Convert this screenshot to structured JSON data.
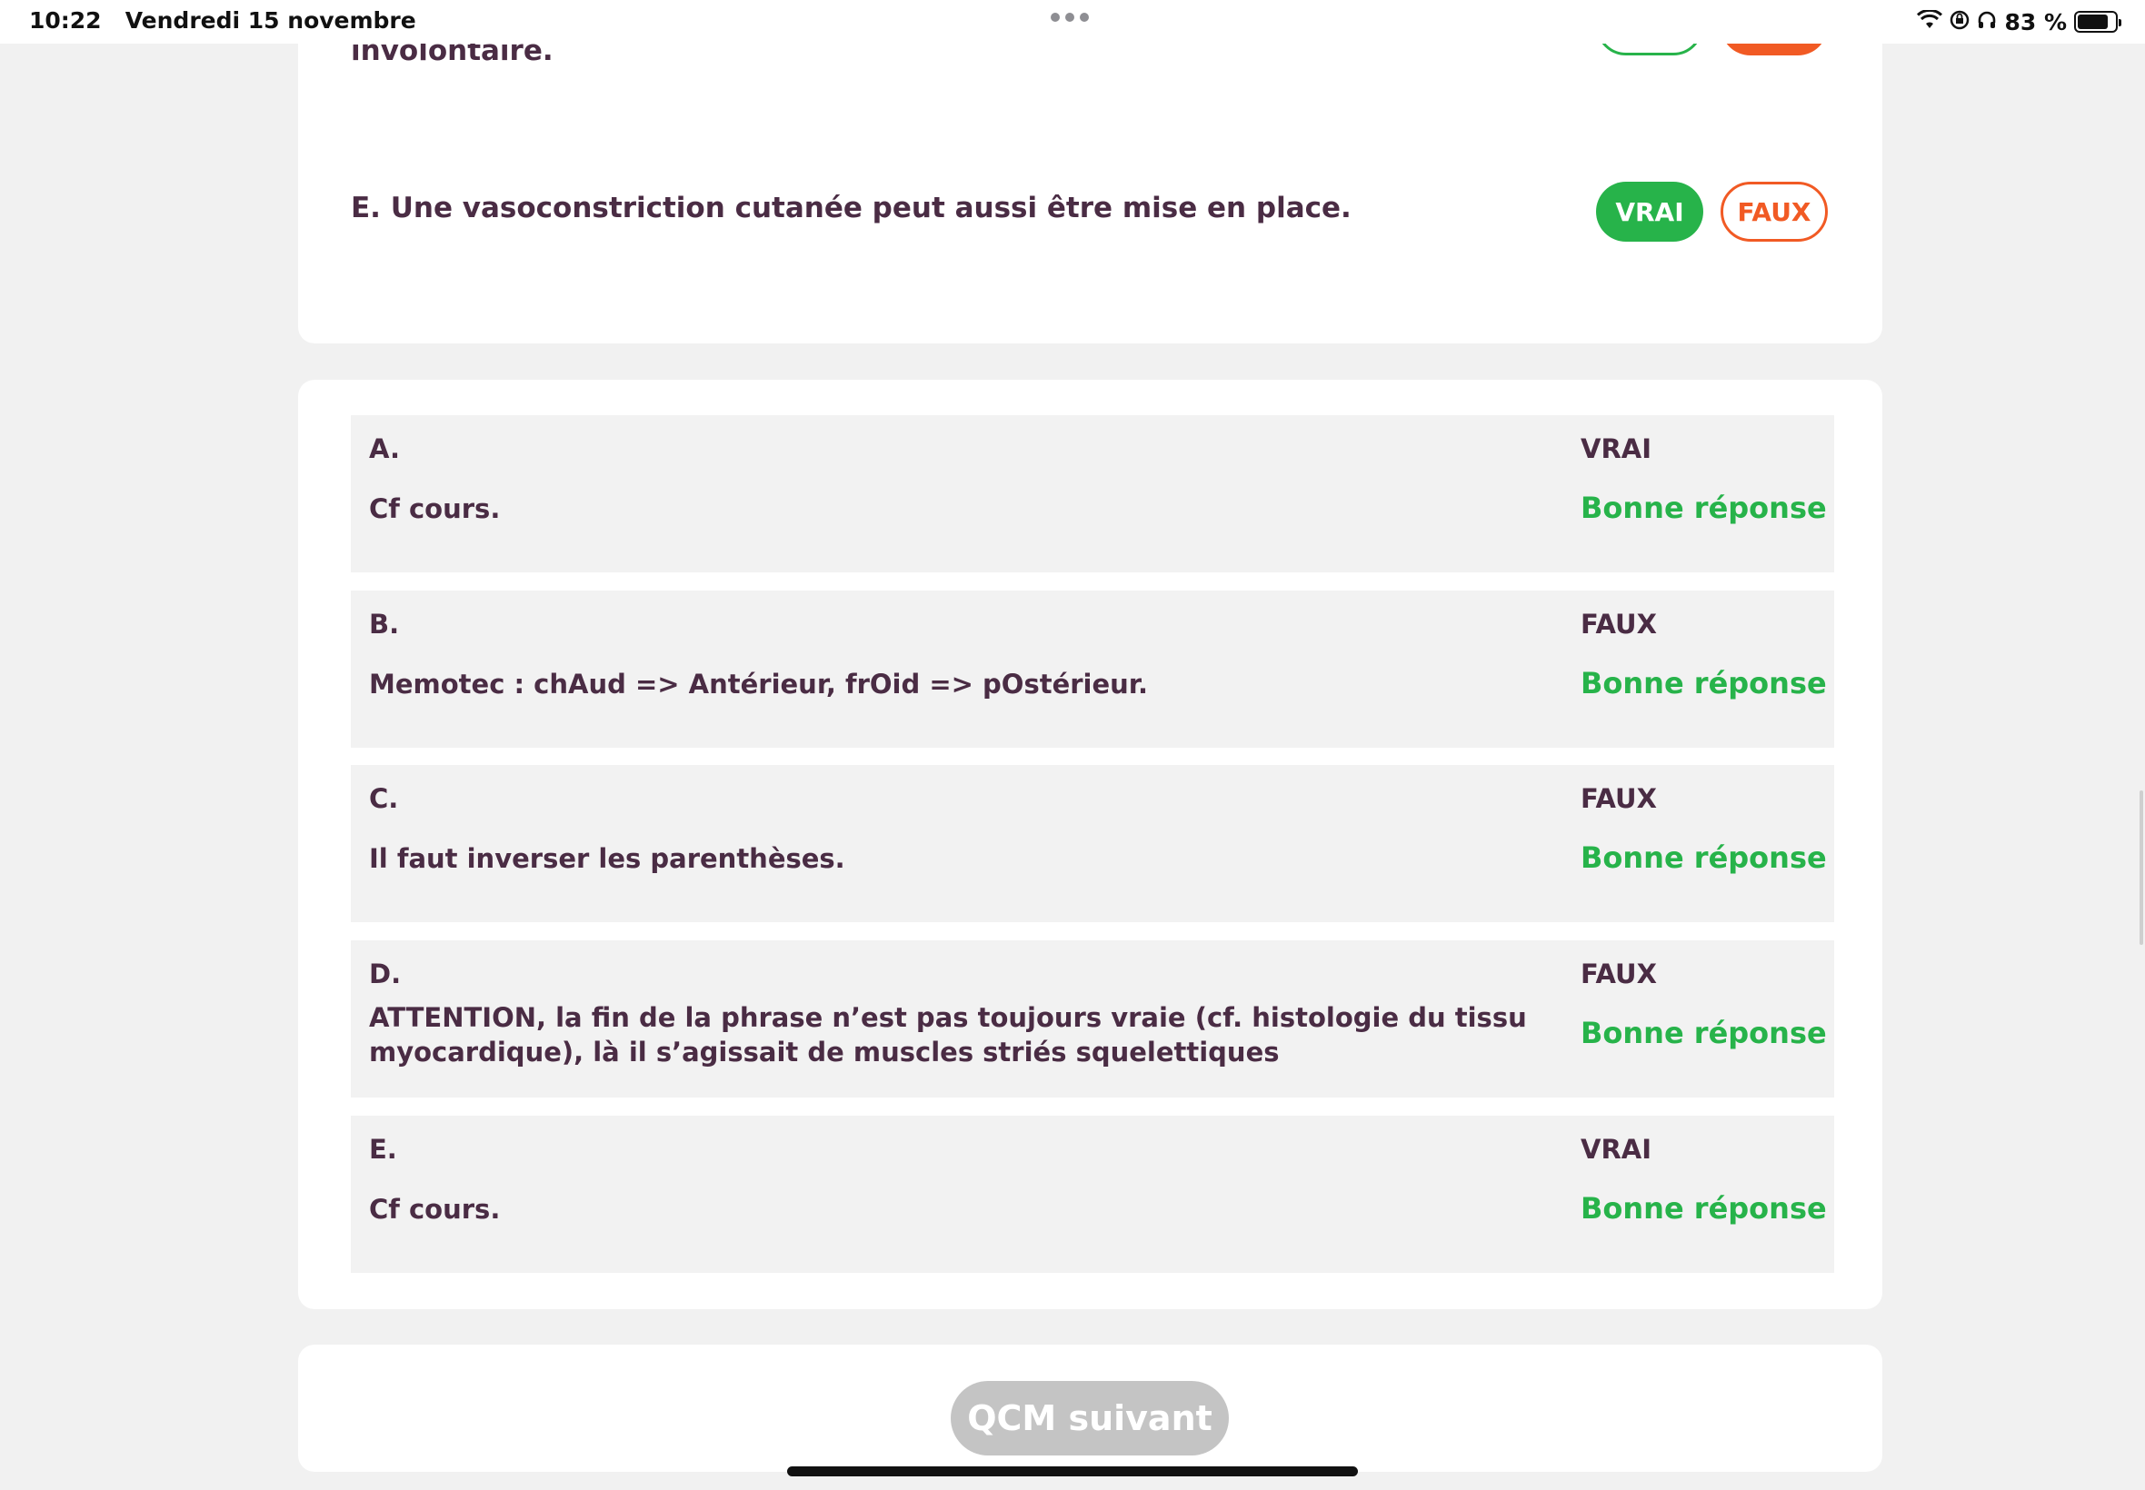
{
  "status_bar": {
    "time_date": "10:22   Vendredi 15 novembre",
    "battery": "83 %"
  },
  "question_card": {
    "partial_text": "involontaire.",
    "statement_e": "E. Une vasoconstriction cutanée peut aussi être mise en place.",
    "vrai_label": "VRAI",
    "faux_label": "FAUX"
  },
  "answers": [
    {
      "letter": "A.",
      "truth": "VRAI",
      "explanation": "Cf cours.",
      "status": "Bonne réponse"
    },
    {
      "letter": "B.",
      "truth": "FAUX",
      "explanation": "Memotec : chAud => Antérieur, frOid => pOstérieur.",
      "status": "Bonne réponse"
    },
    {
      "letter": "C.",
      "truth": "FAUX",
      "explanation": "Il faut inverser les parenthèses.",
      "status": "Bonne réponse"
    },
    {
      "letter": "D.",
      "truth": "FAUX",
      "explanation": "ATTENTION, la fin de la phrase n’est pas toujours vraie (cf. histologie du tissu myocardique), là il s’agissait de muscles striés squelettiques",
      "status": "Bonne réponse"
    },
    {
      "letter": "E.",
      "truth": "VRAI",
      "explanation": "Cf cours.",
      "status": "Bonne réponse"
    }
  ],
  "footer": {
    "next_label": "QCM suivant"
  },
  "colors": {
    "vrai_green": "#27b34a",
    "faux_orange": "#f15a24",
    "text_plum": "#4a2c44",
    "disabled_grey": "#c4c4c4"
  },
  "icons": [
    "wifi-icon",
    "screen-lock-icon",
    "headphones-icon",
    "battery-icon",
    "multitasking-dots-icon"
  ]
}
